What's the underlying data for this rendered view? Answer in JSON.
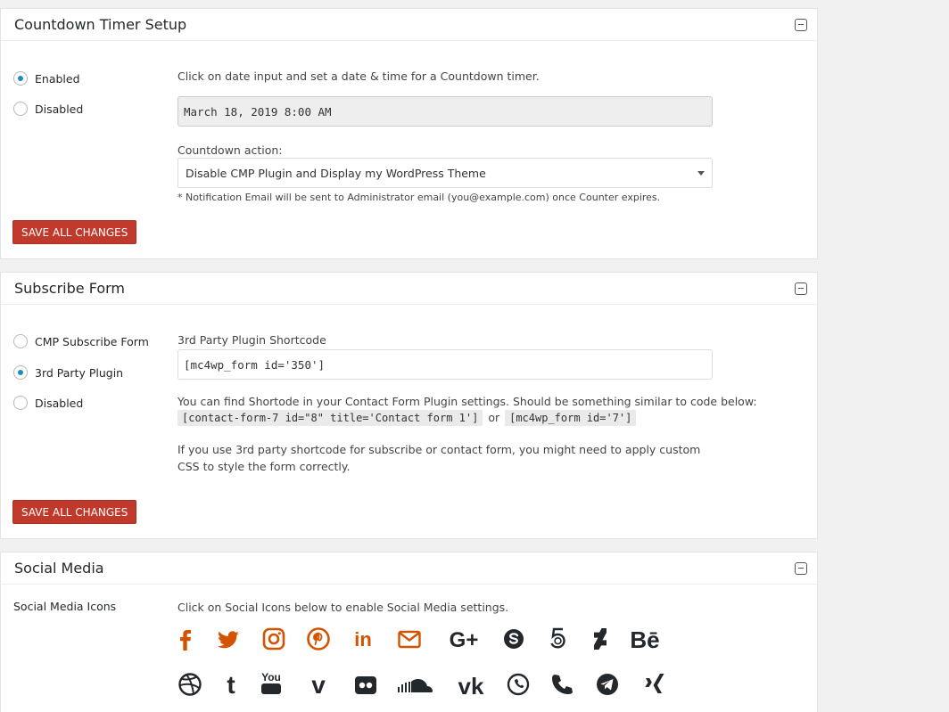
{
  "countdown": {
    "title": "Countdown Timer Setup",
    "radios": [
      {
        "label": "Enabled",
        "checked": true
      },
      {
        "label": "Disabled",
        "checked": false
      }
    ],
    "instruction": "Click on date input and set a date & time for a Countdown timer.",
    "date_value": "March 18, 2019 8:00 AM",
    "action_label": "Countdown action:",
    "action_selected": "Disable CMP Plugin and Display my WordPress Theme",
    "note": "* Notification Email will be sent to Administrator email (you@example.com) once Counter expires.",
    "save_label": "SAVE ALL CHANGES"
  },
  "subscribe": {
    "title": "Subscribe Form",
    "radios": [
      {
        "label": "CMP Subscribe Form",
        "checked": false
      },
      {
        "label": "3rd Party Plugin",
        "checked": true
      },
      {
        "label": "Disabled",
        "checked": false
      }
    ],
    "shortcode_label": "3rd Party Plugin Shortcode",
    "shortcode_value": "[mc4wp_form id='350']",
    "help_text": "You can find Shortode in your Contact Form Plugin settings. Should be something similar to code below:",
    "code_example_1": "[contact-form-7 id=\"8\" title='Contact form 1']",
    "or_text": "or",
    "code_example_2": "[mc4wp_form id='7']",
    "css_note": "If you use 3rd party shortcode for subscribe or contact form, you might need to apply custom CSS to style the form correctly.",
    "save_label": "SAVE ALL CHANGES"
  },
  "social": {
    "title": "Social Media",
    "icons_label": "Social Media Icons",
    "instruction": "Click on Social Icons below to enable Social Media settings.",
    "accent_color": "#d35400",
    "inactive_color": "#23282d",
    "row1_icons": [
      "facebook-icon",
      "twitter-icon",
      "instagram-icon",
      "pinterest-icon",
      "linkedin-icon",
      "email-icon",
      "google-plus-icon",
      "skype-icon",
      "500px-icon",
      "deviantart-icon",
      "behance-icon"
    ],
    "row2_icons": [
      "dribbble-icon",
      "tumblr-icon",
      "youtube-icon",
      "vimeo-icon",
      "flickr-icon",
      "soundcloud-icon",
      "vk-icon",
      "whatsapp-icon",
      "phone-icon",
      "telegram-icon",
      "xing-icon"
    ],
    "text_glyphs": {
      "linkedin": "in",
      "google_plus": "G+",
      "behance": "Bē",
      "tumblr": "t",
      "youtube": "You",
      "vimeo": "v",
      "vk": "vk"
    }
  }
}
